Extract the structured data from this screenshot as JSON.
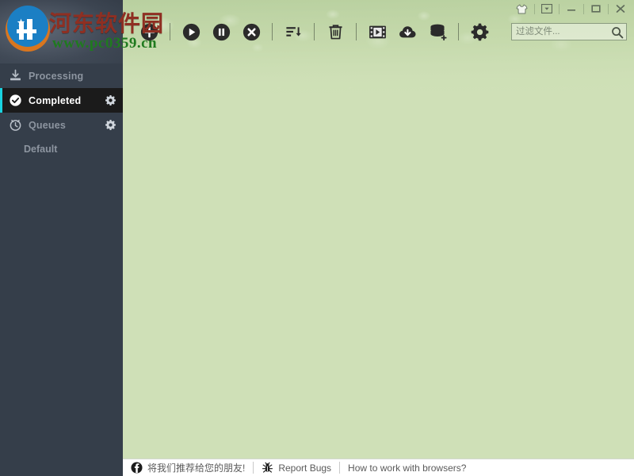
{
  "window": {
    "controls": [
      {
        "name": "skin-icon",
        "tooltip": "Skins"
      },
      {
        "name": "dropdown-icon",
        "tooltip": "Menu"
      },
      {
        "name": "minimize-icon",
        "tooltip": "Minimize"
      },
      {
        "name": "maximize-icon",
        "tooltip": "Maximize"
      },
      {
        "name": "close-icon",
        "tooltip": "Close"
      }
    ]
  },
  "toolbar": {
    "buttons": [
      {
        "name": "add-download-button",
        "icon": "plus-circle-icon"
      },
      {
        "name": "resume-button",
        "icon": "play-circle-icon"
      },
      {
        "name": "pause-button",
        "icon": "pause-circle-icon"
      },
      {
        "name": "stop-button",
        "icon": "stop-circle-icon"
      },
      {
        "name": "sort-button",
        "icon": "sort-descending-icon"
      },
      {
        "name": "delete-button",
        "icon": "trash-icon"
      },
      {
        "name": "video-button",
        "icon": "film-play-icon"
      },
      {
        "name": "cloud-download-button",
        "icon": "cloud-download-icon"
      },
      {
        "name": "database-button",
        "icon": "database-add-icon"
      },
      {
        "name": "settings-button",
        "icon": "gear-icon"
      }
    ]
  },
  "search": {
    "placeholder": "过滤文件...",
    "value": "",
    "icon": "search-icon"
  },
  "sidebar": {
    "items": [
      {
        "label": "Processing",
        "icon": "download-tray-icon",
        "selected": false,
        "gear": false
      },
      {
        "label": "Completed",
        "icon": "check-circle-icon",
        "selected": true,
        "gear": true
      },
      {
        "label": "Queues",
        "icon": "clock-icon",
        "selected": false,
        "gear": true
      }
    ],
    "sub_items": [
      {
        "label": "Default"
      }
    ]
  },
  "statusbar": {
    "items": [
      {
        "label": "将我们推荐给您的朋友!",
        "icon": "facebook-icon"
      },
      {
        "label": "Report Bugs",
        "icon": "bug-icon"
      },
      {
        "label": "How to work with browsers?",
        "icon": ""
      }
    ]
  },
  "watermark": {
    "site_name": "河东软件园",
    "url": "www.pc0359.cn"
  },
  "colors": {
    "sidebar_bg": "#353e4a",
    "sidebar_selected_bg": "#1b1b1b",
    "accent": "#19d3e0",
    "content_bg": "#cfe0b7",
    "statusbar_bg": "#ffffff",
    "watermark_red": "#8f2f22",
    "watermark_green": "#1f7a1f"
  }
}
